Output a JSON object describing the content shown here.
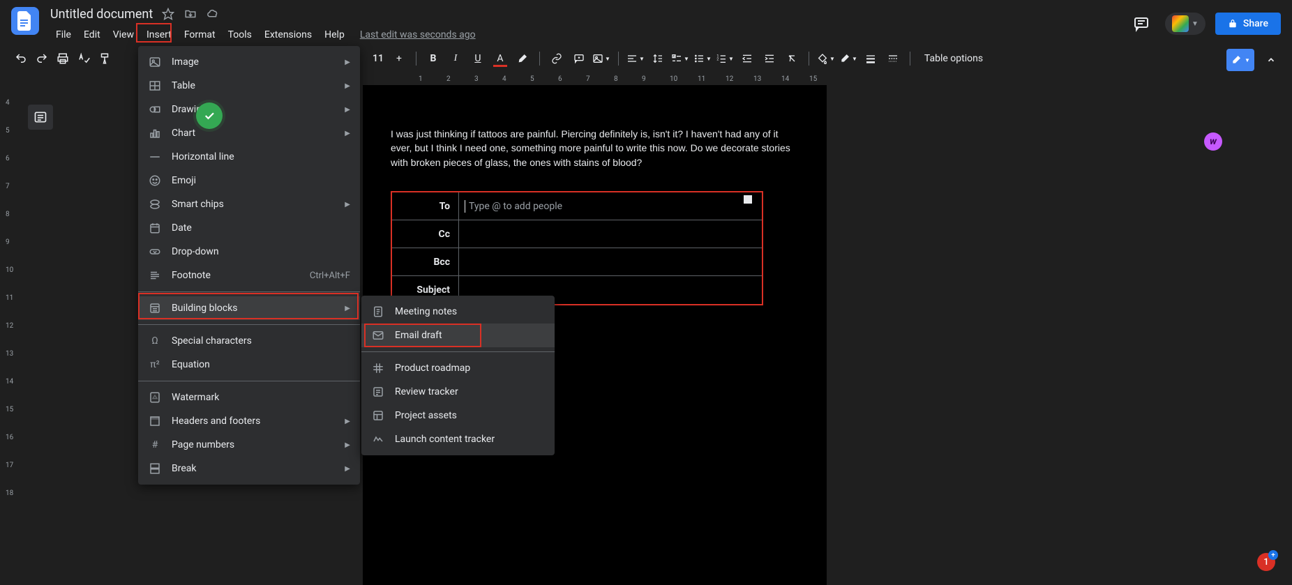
{
  "header": {
    "doc_title": "Untitled document",
    "menus": [
      "File",
      "Edit",
      "View",
      "Insert",
      "Format",
      "Tools",
      "Extensions",
      "Help"
    ],
    "last_edit": "Last edit was seconds ago",
    "share_label": "Share"
  },
  "toolbar": {
    "font_size": "11",
    "table_options": "Table options"
  },
  "ruler_h": [
    "1",
    "2",
    "3",
    "4",
    "5",
    "6",
    "7",
    "8",
    "9",
    "10",
    "11",
    "12",
    "13",
    "14",
    "15"
  ],
  "ruler_v": [
    "4",
    "5",
    "6",
    "7",
    "8",
    "9",
    "10",
    "11",
    "12",
    "13",
    "14",
    "15",
    "16",
    "17",
    "18"
  ],
  "body_text": "I was just thinking if tattoos are painful. Piercing definitely is, isn't it? I haven't had any of it ever, but I think I need one, something more painful to write this now. Do we decorate stories with broken pieces of glass, the ones with stains of blood?",
  "email": {
    "fields": [
      {
        "label": "To",
        "placeholder": "Type @ to add people"
      },
      {
        "label": "Cc",
        "placeholder": ""
      },
      {
        "label": "Bcc",
        "placeholder": ""
      },
      {
        "label": "Subject",
        "placeholder": ""
      }
    ]
  },
  "insert_menu": {
    "items_a": [
      {
        "label": "Image",
        "arrow": true,
        "icon": "image"
      },
      {
        "label": "Table",
        "arrow": true,
        "icon": "table"
      },
      {
        "label": "Drawing",
        "arrow": true,
        "icon": "drawing"
      },
      {
        "label": "Chart",
        "arrow": true,
        "icon": "chart"
      },
      {
        "label": "Horizontal line",
        "arrow": false,
        "icon": "hline"
      },
      {
        "label": "Emoji",
        "arrow": false,
        "icon": "emoji"
      },
      {
        "label": "Smart chips",
        "arrow": true,
        "icon": "chips"
      },
      {
        "label": "Date",
        "arrow": false,
        "icon": "date"
      },
      {
        "label": "Drop-down",
        "arrow": false,
        "icon": "dropdown"
      },
      {
        "label": "Footnote",
        "arrow": false,
        "icon": "footnote",
        "shortcut": "Ctrl+Alt+F"
      }
    ],
    "items_b": [
      {
        "label": "Building blocks",
        "arrow": true,
        "icon": "blocks"
      }
    ],
    "items_c": [
      {
        "label": "Special characters",
        "arrow": false,
        "icon": "omega"
      },
      {
        "label": "Equation",
        "arrow": false,
        "icon": "pi"
      }
    ],
    "items_d": [
      {
        "label": "Watermark",
        "arrow": false,
        "icon": "watermark"
      },
      {
        "label": "Headers and footers",
        "arrow": true,
        "icon": "headers"
      },
      {
        "label": "Page numbers",
        "arrow": true,
        "icon": "hash"
      },
      {
        "label": "Break",
        "arrow": true,
        "icon": "break"
      }
    ]
  },
  "submenu": {
    "items_a": [
      {
        "label": "Meeting notes",
        "icon": "doc"
      },
      {
        "label": "Email draft",
        "icon": "email"
      }
    ],
    "items_b": [
      {
        "label": "Product roadmap",
        "icon": "roadmap"
      },
      {
        "label": "Review tracker",
        "icon": "review"
      },
      {
        "label": "Project assets",
        "icon": "assets"
      },
      {
        "label": "Launch content tracker",
        "icon": "launch"
      }
    ]
  },
  "badges": {
    "notif_count": "1",
    "purple_letter": "w"
  }
}
